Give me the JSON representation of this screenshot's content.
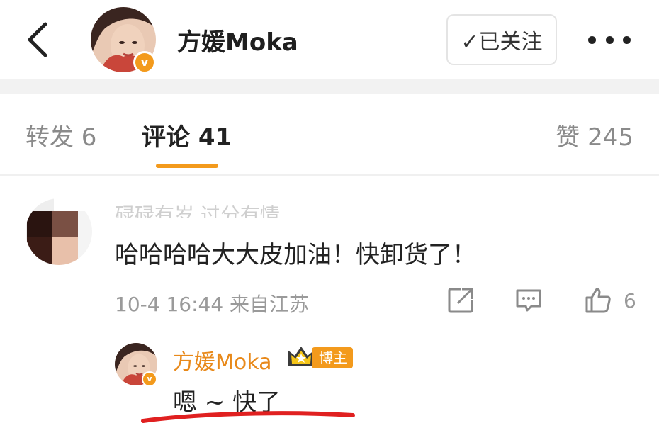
{
  "header": {
    "username": "方媛Moka",
    "follow_label": "✓已关注",
    "verified_badge": "v"
  },
  "tabs": {
    "repost": "转发 6",
    "comment": "评论 41",
    "like": "赞 245"
  },
  "comment": {
    "author": "碌碌有岁 过分有情",
    "text": "哈哈哈哈大大皮加油！快卸货了！",
    "meta": "10-4 16:44 来自江苏",
    "like_count": "6"
  },
  "reply": {
    "author": "方媛Moka",
    "badge": "博主",
    "verified_badge": "v",
    "text": "嗯 ~ 快了"
  },
  "colors": {
    "accent": "#f39a1c",
    "reply_name": "#e8891a",
    "underline_annotation": "#e02020",
    "muted_text": "#9a9a9a"
  },
  "icons": [
    "back-chevron-icon",
    "more-dots-icon",
    "share-icon",
    "comment-icon",
    "thumbs-up-icon",
    "crown-icon"
  ]
}
